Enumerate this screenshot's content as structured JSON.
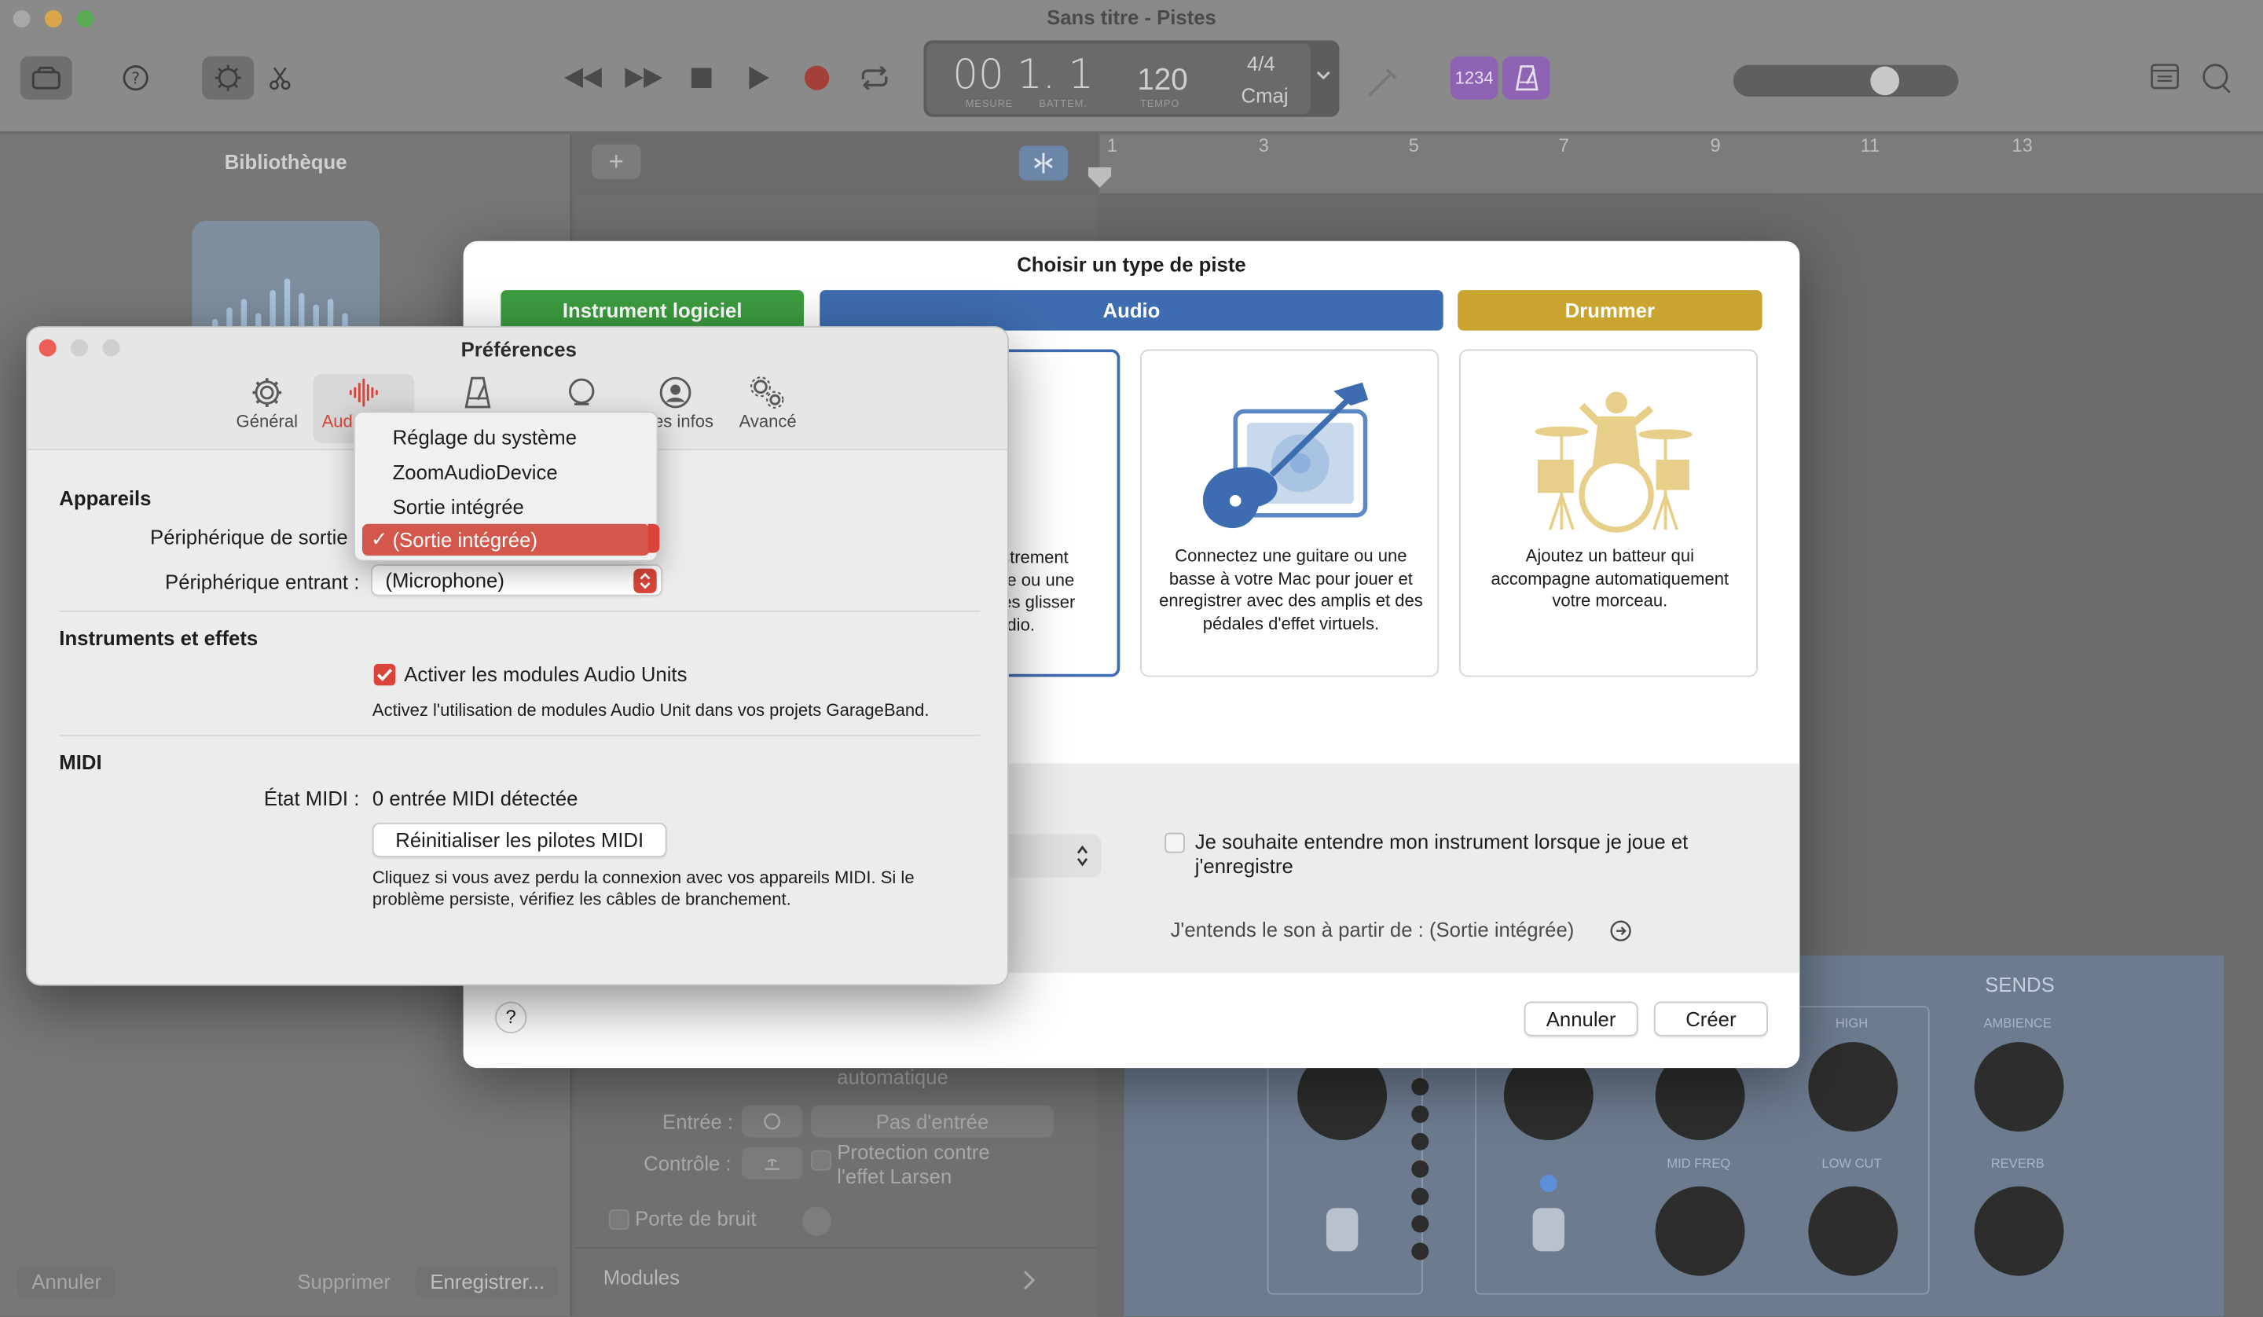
{
  "main_window": {
    "title": "Sans titre - Pistes",
    "lcd": {
      "position": "00 1. 1",
      "label_measure": "MESURE",
      "label_beat": "BATTEM.",
      "tempo": "120",
      "tempo_label": "TEMPO",
      "signature": "4/4",
      "key": "Cmaj"
    },
    "count_in_badge": "1234",
    "ruler_numbers": [
      "1",
      "3",
      "5",
      "7",
      "9",
      "11",
      "13"
    ],
    "volume_level": 0.66
  },
  "library": {
    "title": "Bibliothèque",
    "cancel": "Annuler",
    "delete": "Supprimer",
    "save": "Enregistrer..."
  },
  "smart_controls": {
    "input_label": "Entrée :",
    "input_value": "Pas d'entrée",
    "monitor_label": "Contrôle :",
    "feedback_line1": "Protection contre",
    "feedback_line2": "l'effet Larsen",
    "level_line": "automatique",
    "noise_gate": "Porte de bruit",
    "modules": "Modules"
  },
  "mixer": {
    "sends": "SENDS",
    "high": "HIGH",
    "ambience": "AMBIENCE",
    "mid_freq": "MID FREQ",
    "low_cut": "LOW CUT",
    "reverb": "REVERB"
  },
  "track_dialog": {
    "title": "Choisir un type de piste",
    "tabs": {
      "software_instrument": "Instrument logiciel",
      "audio": "Audio",
      "drummer": "Drummer"
    },
    "card_mic_text": "istrement\nne ou une\ntes glisser\nudio.",
    "card_guitar_text": "Connectez une guitare ou une basse à votre Mac pour jouer et enregistrer avec des amplis et des pédales d'effet virtuels.",
    "card_drummer_text": "Ajoutez un batteur qui accompagne automatiquement votre morceau.",
    "monitor_checkbox": "Je souhaite entendre mon instrument lorsque je joue et j'enregistre",
    "output_line": "J'entends le son à partir de : (Sortie intégrée)",
    "help": "?",
    "cancel": "Annuler",
    "create": "Créer",
    "colors": {
      "software_instrument": "#3c9c3f",
      "audio": "#3e6cb0",
      "drummer": "#c9a42f"
    }
  },
  "preferences": {
    "title": "Préférences",
    "tabs": {
      "general": "Général",
      "audio": "Aud",
      "my_info": "es infos",
      "advanced": "Avancé"
    },
    "devices_section": "Appareils",
    "output_label": "Périphérique de sortie",
    "input_label": "Périphérique entrant :",
    "input_value": "(Microphone)",
    "instruments_section": "Instruments et effets",
    "au_checkbox": "Activer les modules Audio Units",
    "au_desc": "Activez l'utilisation de modules Audio Unit dans vos projets GarageBand.",
    "midi_section": "MIDI",
    "midi_state_label": "État MIDI :",
    "midi_state_value": "0 entrée MIDI détectée",
    "reset_midi": "Réinitialiser les pilotes MIDI",
    "midi_desc": "Cliquez si vous avez perdu la connexion avec vos appareils MIDI. Si le problème persiste, vérifiez les câbles de branchement.",
    "accent": "#d9453a"
  },
  "output_menu": {
    "items": [
      "Réglage du système",
      "ZoomAudioDevice",
      "Sortie intégrée",
      "(Sortie intégrée)"
    ],
    "selected_index": 3,
    "check": "✓"
  }
}
